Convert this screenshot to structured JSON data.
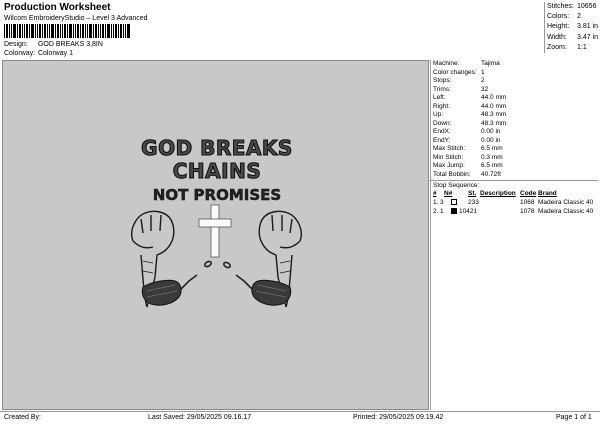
{
  "header": {
    "title": "Production Worksheet",
    "subtitle": "Wilcom EmbroideryStudio – Level 3 Advanced"
  },
  "meta": {
    "design_label": "Design:",
    "design_value": "GOD BREAKS 3,8IN",
    "colorway_label": "Colorway:",
    "colorway_value": "Colorway 1"
  },
  "summary": [
    {
      "label": "Stitches:",
      "value": "10656"
    },
    {
      "label": "Colors:",
      "value": "2"
    },
    {
      "label": "Height:",
      "value": "3.81 in"
    },
    {
      "label": "Width:",
      "value": "3.47 in"
    },
    {
      "label": "Zoom:",
      "value": "1:1"
    }
  ],
  "design_text": {
    "line1": "GOD BREAKS",
    "line2": "CHAINS",
    "line3": "NOT PROMISES"
  },
  "details": [
    {
      "label": "Machine:",
      "value": "Tajima"
    },
    {
      "label": "Color changes:",
      "value": "1"
    },
    {
      "label": "Stops:",
      "value": "2"
    },
    {
      "label": "Trims:",
      "value": "32"
    },
    {
      "label": "Left:",
      "value": "44.0 mm"
    },
    {
      "label": "Right:",
      "value": "44.0 mm"
    },
    {
      "label": "Up:",
      "value": "48.3 mm"
    },
    {
      "label": "Down:",
      "value": "48.3 mm"
    },
    {
      "label": "EndX:",
      "value": "0.00 in"
    },
    {
      "label": "EndY:",
      "value": "0.00 in"
    },
    {
      "label": "Max Stitch:",
      "value": "6.5 mm"
    },
    {
      "label": "Min Stitch:",
      "value": "0.3 mm"
    },
    {
      "label": "Max Jump:",
      "value": "6.5 mm"
    },
    {
      "label": "Total Bobbin:",
      "value": "40.72ft"
    }
  ],
  "stop_sequence": {
    "title": "Stop Sequence:",
    "columns": [
      "#",
      "N#",
      "St.",
      "Description",
      "Code",
      "Brand"
    ],
    "rows": [
      {
        "index": "1.",
        "needle": "3",
        "color": "#ffffff",
        "stitches": "233",
        "description": "",
        "code": "1068",
        "brand": "Madeira Classic 40"
      },
      {
        "index": "2.",
        "needle": "1",
        "color": "#000000",
        "stitches": "10421",
        "description": "",
        "code": "1078",
        "brand": "Madeira Classic 40"
      }
    ]
  },
  "footer": {
    "created_by": "Created By:",
    "last_saved": "Last Saved: 29/05/2025 09.16.17",
    "printed": "Printed: 29/05/2025 09.19.42",
    "page": "Page 1 of 1"
  },
  "colors": {
    "design_background": "#c8c8c8",
    "thread_black": "#000000",
    "thread_white": "#ffffff"
  }
}
